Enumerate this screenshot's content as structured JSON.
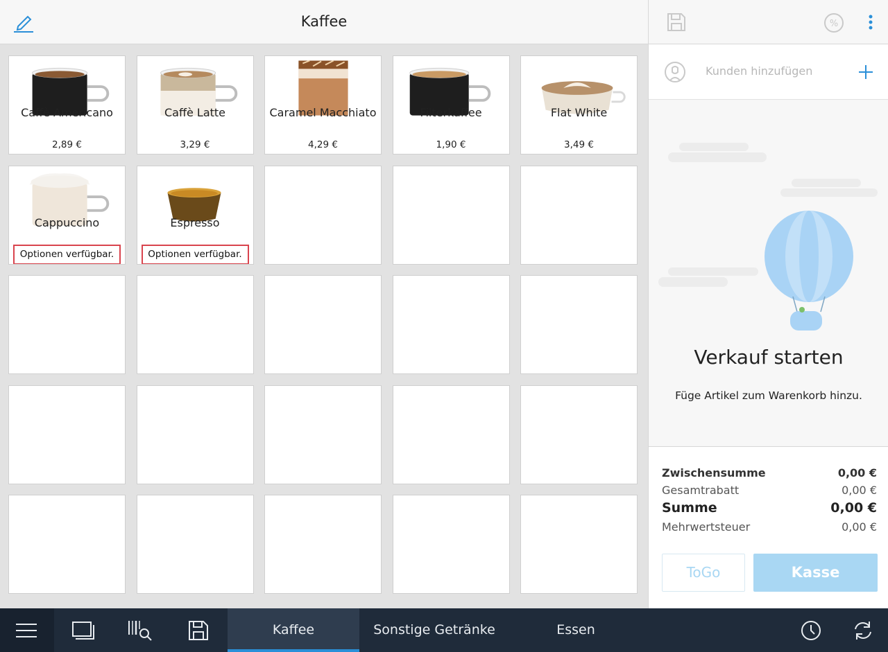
{
  "header": {
    "title": "Kaffee"
  },
  "products": [
    {
      "name": "Caffè Americano",
      "price": "2,89 €",
      "kind": "americano"
    },
    {
      "name": "Caffè Latte",
      "price": "3,29 €",
      "kind": "latte"
    },
    {
      "name": "Caramel Macchiato",
      "price": "4,29 €",
      "kind": "macchiato"
    },
    {
      "name": "Filterkaffee",
      "price": "1,90 €",
      "kind": "filter"
    },
    {
      "name": "Flat White",
      "price": "3,49 €",
      "kind": "flatwhite"
    },
    {
      "name": "Cappuccino",
      "options": "Optionen verfügbar.",
      "kind": "cappuccino"
    },
    {
      "name": "Espresso",
      "options": "Optionen verfügbar.",
      "kind": "espresso"
    }
  ],
  "customer": {
    "add_label": "Kunden hinzufügen"
  },
  "empty_state": {
    "title": "Verkauf starten",
    "subtitle": "Füge Artikel zum Warenkorb hinzu."
  },
  "totals": {
    "subtotal_label": "Zwischensumme",
    "subtotal_value": "0,00 €",
    "discount_label": "Gesamtrabatt",
    "discount_value": "0,00 €",
    "sum_label": "Summe",
    "sum_value": "0,00 €",
    "vat_label": "Mehrwertsteuer",
    "vat_value": "0,00 €"
  },
  "buttons": {
    "togo": "ToGo",
    "checkout": "Kasse"
  },
  "tabs": [
    {
      "label": "Kaffee",
      "active": true
    },
    {
      "label": "Sonstige Getränke",
      "active": false
    },
    {
      "label": "Essen",
      "active": false
    }
  ],
  "colors": {
    "accent": "#2a8fd8",
    "accent_light": "#a9d7f3",
    "bottom_bar": "#1f2b3a",
    "option_border": "#d9434d"
  }
}
